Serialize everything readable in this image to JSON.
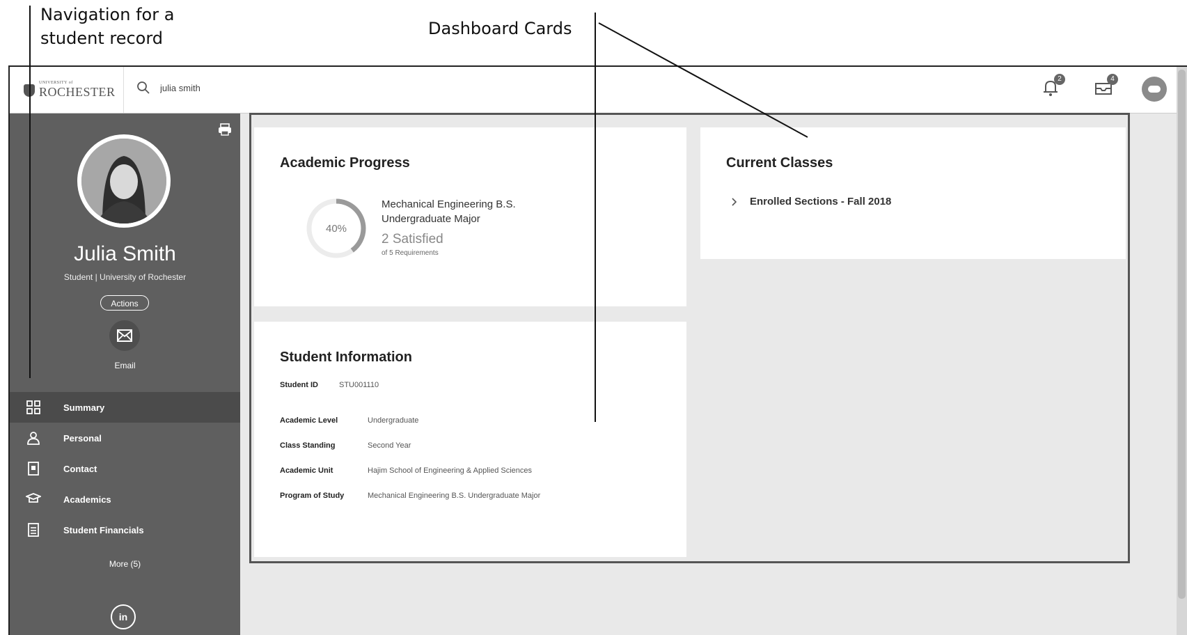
{
  "annotations": {
    "nav_label": "Navigation for a student record",
    "cards_label": "Dashboard Cards"
  },
  "topbar": {
    "logo_small": "UNIVERSITY of",
    "logo_text": "ROCHESTER",
    "search_value": "julia smith",
    "notifications_count": "2",
    "inbox_count": "4"
  },
  "profile": {
    "name": "Julia Smith",
    "subtitle": "Student | University of Rochester",
    "actions_label": "Actions",
    "email_label": "Email"
  },
  "nav": {
    "items": [
      {
        "label": "Summary",
        "icon": "summary-grid-icon",
        "active": true
      },
      {
        "label": "Personal",
        "icon": "person-icon"
      },
      {
        "label": "Contact",
        "icon": "contact-book-icon"
      },
      {
        "label": "Academics",
        "icon": "graduation-cap-icon"
      },
      {
        "label": "Student Financials",
        "icon": "document-icon"
      }
    ],
    "more_label": "More (5)",
    "linkedin_label": "in"
  },
  "academic_progress": {
    "title": "Academic Progress",
    "percent": 40,
    "percent_label": "40%",
    "program_line1": "Mechanical Engineering B.S.",
    "program_line2": "Undergraduate Major",
    "satisfied": "2 Satisfied",
    "requirements": "of 5 Requirements"
  },
  "current_classes": {
    "title": "Current Classes",
    "item": "Enrolled Sections - Fall 2018"
  },
  "student_information": {
    "title": "Student Information",
    "student_id_label": "Student ID",
    "student_id": "STU001110",
    "fields": [
      {
        "label": "Academic Level",
        "value": "Undergraduate"
      },
      {
        "label": "Class Standing",
        "value": "Second Year"
      },
      {
        "label": "Academic Unit",
        "value": "Hajim School of Engineering & Applied Sciences"
      },
      {
        "label": "Program of Study",
        "value": "Mechanical Engineering B.S. Undergraduate Major"
      }
    ]
  },
  "colors": {
    "sidebar_bg": "#5f5f5f",
    "sidebar_active": "#4b4b4b",
    "dashboard_bg": "#e9e9e9",
    "card_bg": "#ffffff"
  }
}
